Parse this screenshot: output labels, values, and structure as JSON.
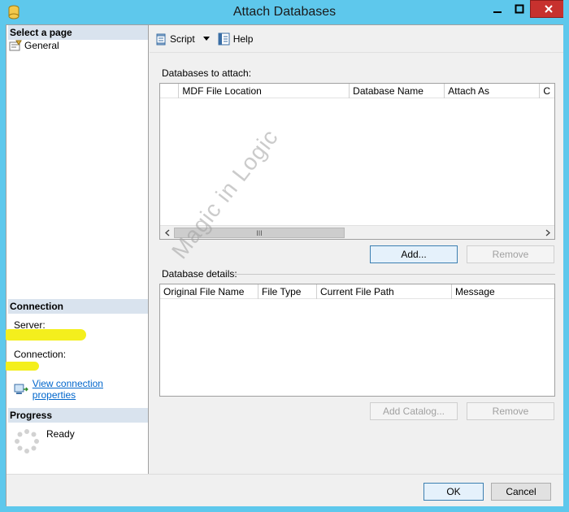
{
  "window": {
    "title": "Attach Databases",
    "title_bar_color": "#5ec8ec",
    "close_button_color": "#c7312e"
  },
  "left_pane": {
    "select_page_header": "Select a page",
    "pages": [
      {
        "label": "General",
        "icon": "properties-page-icon"
      }
    ],
    "connection_header": "Connection",
    "server_label": "Server:",
    "connection_label": "Connection:",
    "view_connection_link": "View connection properties",
    "progress_header": "Progress",
    "progress_status": "Ready"
  },
  "toolbar": {
    "script_label": "Script",
    "help_label": "Help"
  },
  "attach_section": {
    "title": "Databases to attach:",
    "columns": [
      "MDF File Location",
      "Database Name",
      "Attach As",
      "C"
    ],
    "add_button": "Add...",
    "remove_button": "Remove",
    "scroll_thumb_glyph": "III"
  },
  "details_section": {
    "title": "Database details:",
    "columns": [
      "Original File Name",
      "File Type",
      "Current File Path",
      "Message"
    ],
    "add_catalog_button": "Add Catalog...",
    "remove_button": "Remove"
  },
  "footer": {
    "ok_button": "OK",
    "cancel_button": "Cancel"
  },
  "watermark": "Magic in Logic",
  "colors": {
    "section_header_bg": "#d9e3ee",
    "highlight_yellow": "#f4ef1d",
    "link_blue": "#0066cc"
  }
}
